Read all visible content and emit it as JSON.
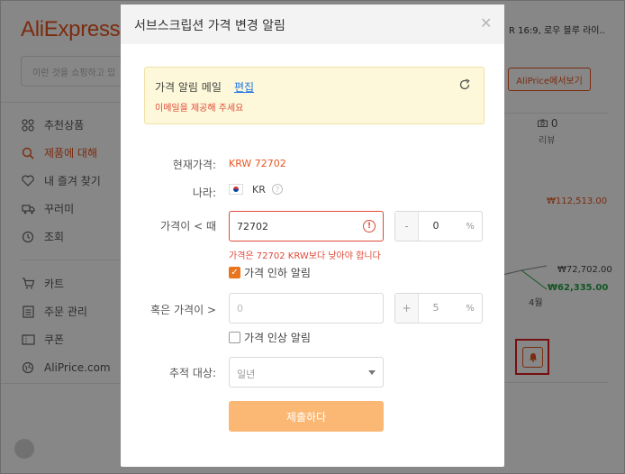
{
  "background": {
    "logo": "AliExpress",
    "search_placeholder": "이런 것을 쇼핑하고 있",
    "nav": [
      {
        "label": "추천상품",
        "icon": "grid-icon"
      },
      {
        "label": "제품에 대해",
        "icon": "search-icon",
        "active": true
      },
      {
        "label": "내 즐겨 찾기",
        "icon": "heart-icon"
      },
      {
        "label": "꾸러미",
        "icon": "truck-icon"
      },
      {
        "label": "조회",
        "icon": "clock-icon"
      }
    ],
    "nav2": [
      {
        "label": "카트",
        "icon": "cart-icon"
      },
      {
        "label": "주문 관리",
        "icon": "list-icon"
      },
      {
        "label": "쿠폰",
        "icon": "coupon-icon"
      },
      {
        "label": "AliPrice.com",
        "icon": "globe-icon"
      }
    ],
    "product_title": "R 16:9, 로우 블루 라이..",
    "aliprice_button": "AliPrice에서보기",
    "review_count": "0",
    "review_label": "리뷰",
    "price_high": "₩112,513.00",
    "price_mid": "₩72,702.00",
    "price_low": "₩62,335.00",
    "month_label": "4월"
  },
  "modal": {
    "title": "서브스크립션 가격 변경 알림",
    "notice": {
      "title": "가격 알림 메일",
      "edit": "편집",
      "warning": "이메일을 제공해 주세요"
    },
    "current_price_label": "현재가격:",
    "current_price": "KRW  72702",
    "country_label": "나라:",
    "country": "KR",
    "price_below_label": "가격이 < 때",
    "price_below_value": "72702",
    "percent_down_sign": "-",
    "percent_down_value": "0",
    "percent_unit": "%",
    "error_message": "가격은 72702 KRW보다 낮아야 합니다",
    "price_drop_alert": "가격 인하 알림",
    "price_above_label": "혹은 가격이 >",
    "price_above_placeholder": "0",
    "percent_up_sign": "+",
    "percent_up_value": "5",
    "price_rise_alert": "가격 인상 알림",
    "tracking_label": "추적 대상:",
    "tracking_value": "일년",
    "submit": "제출하다"
  }
}
